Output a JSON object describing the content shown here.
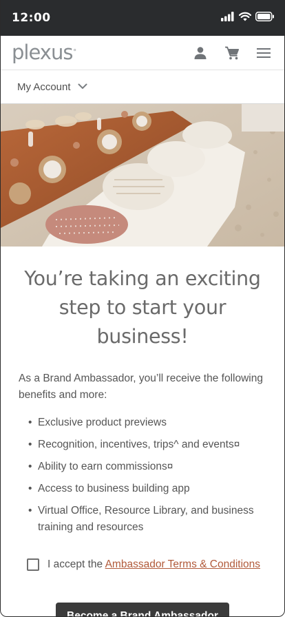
{
  "status_bar": {
    "time": "12:00"
  },
  "header": {
    "logo_text": "plexus",
    "logo_mark": "°"
  },
  "account": {
    "label": "My Account"
  },
  "hero": {
    "image_alt": ""
  },
  "main": {
    "headline": "You’re taking an exciting step to start your business!",
    "intro": "As a Brand Ambassador, you’ll receive the following benefits and more:",
    "benefits": [
      "Exclusive product previews",
      " Recognition, incentives, trips^ and events¤",
      "Ability to earn commissions¤",
      "Access to business building app",
      "Virtual Office, Resource Library, and business training and resources"
    ],
    "accept_prefix": "I accept the ",
    "terms_link": "Ambassador Terms & Conditions",
    "cta_label": "Become a Brand Ambassador"
  },
  "colors": {
    "status_bar_bg": "#2a2c2e",
    "link": "#b15a3a",
    "cta_bg": "#3b3b3b",
    "logo": "#8a8f93"
  }
}
